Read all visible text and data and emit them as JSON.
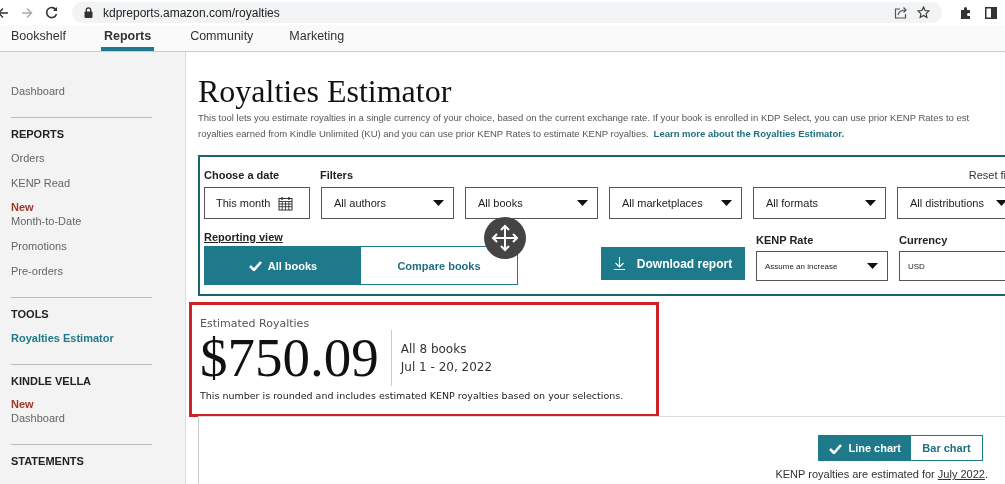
{
  "browser": {
    "url": "kdpreports.amazon.com/royalties"
  },
  "nav_tabs": [
    {
      "label": "Bookshelf",
      "selected": false
    },
    {
      "label": "Reports",
      "selected": true
    },
    {
      "label": "Community",
      "selected": false
    },
    {
      "label": "Marketing",
      "selected": false
    }
  ],
  "sidebar": {
    "items": [
      {
        "kind": "link",
        "label": "Dashboard",
        "selected": false
      },
      {
        "kind": "divider"
      },
      {
        "kind": "heading",
        "label": "REPORTS"
      },
      {
        "kind": "link",
        "label": "Orders",
        "selected": false
      },
      {
        "kind": "link",
        "label": "KENP Read",
        "selected": false
      },
      {
        "kind": "link",
        "badge": "New",
        "label": "Month-to-Date",
        "selected": false
      },
      {
        "kind": "link",
        "label": "Promotions",
        "selected": false
      },
      {
        "kind": "link",
        "label": "Pre-orders",
        "selected": false
      },
      {
        "kind": "divider"
      },
      {
        "kind": "heading",
        "label": "TOOLS"
      },
      {
        "kind": "link",
        "label": "Royalties Estimator",
        "selected": true
      },
      {
        "kind": "divider"
      },
      {
        "kind": "heading",
        "label": "KINDLE VELLA"
      },
      {
        "kind": "link",
        "badge": "New",
        "label": "Dashboard",
        "selected": false
      },
      {
        "kind": "divider"
      },
      {
        "kind": "heading",
        "label": "STATEMENTS"
      }
    ]
  },
  "title": "Royalties Estimator",
  "description_lines": [
    "This tool lets you estimate royalties in a single currency of your choice, based on the current exchange rate. If your book is enrolled in KDP Select, you can use prior KENP Rates to est",
    "royalties earned from Kindle Unlimited (KU) and you can use prior KENP Rates to estimate KENP royalties."
  ],
  "learn_more_link": "Learn more about the Royalties Estimator.",
  "filters_panel": {
    "date_label": "Choose a date",
    "date_value": "This month",
    "filters_label": "Filters",
    "reset_link": "Reset fi",
    "dropdowns": [
      "All authors",
      "All books",
      "All marketplaces",
      "All formats",
      "All distributions"
    ],
    "reporting_view_label": "Reporting view",
    "view_toggle": [
      {
        "label": "All books",
        "selected": true
      },
      {
        "label": "Compare books",
        "selected": false
      }
    ],
    "download_button": "Download report",
    "kenp_rate": {
      "label": "KENP Rate",
      "value": "Assume an increase"
    },
    "currency": {
      "label": "Currency",
      "value": "USD"
    }
  },
  "estimate": {
    "highlighted": true,
    "label": "Estimated Royalties",
    "amount": "$750.09",
    "books": "All 8 books",
    "dates": "Jul 1 - 20, 2022",
    "note": "This number is rounded and includes estimated KENP royalties based on your selections."
  },
  "chart_toggle": [
    {
      "label": "Line chart",
      "selected": true
    },
    {
      "label": "Bar chart",
      "selected": false
    }
  ],
  "footnote": {
    "text": "KENP royalties are estimated for",
    "link": "July 2022",
    "end": "."
  }
}
